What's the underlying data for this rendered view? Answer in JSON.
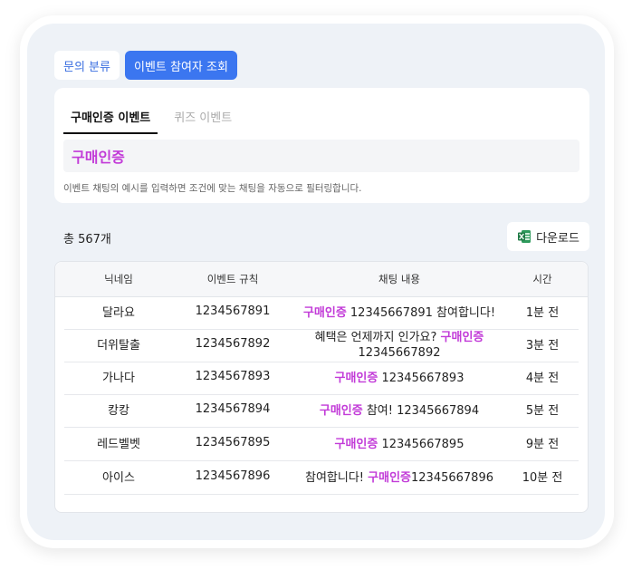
{
  "top_tabs": [
    {
      "label": "문의 분류",
      "active": false
    },
    {
      "label": "이벤트 참여자 조회",
      "active": true
    }
  ],
  "sub_tabs": [
    {
      "label": "구매인증 이벤트",
      "active": true
    },
    {
      "label": "퀴즈 이벤트",
      "active": false
    }
  ],
  "keyword": "구매인증",
  "help_text": "이벤트 채팅의 예시를 입력하면 조건에 맞는 채팅을 자동으로 필터링합니다.",
  "total_label": "총 567개",
  "download_label": "다운로드",
  "table": {
    "headers": [
      "닉네임",
      "이벤트 규칙",
      "채팅 내용",
      "시간"
    ],
    "rows": [
      {
        "nickname": "달라요",
        "rule": "1234567891",
        "chat": [
          {
            "t": "구매인증",
            "hl": true
          },
          {
            "t": " 12345667891 참여합니다!",
            "hl": false
          }
        ],
        "time": "1분 전"
      },
      {
        "nickname": "더위탈출",
        "rule": "1234567892",
        "chat": [
          {
            "t": "혜택은 언제까지 인가요? ",
            "hl": false
          },
          {
            "t": "구매인증",
            "hl": true
          },
          {
            "t": " 12345667892",
            "hl": false
          }
        ],
        "time": "3분 전"
      },
      {
        "nickname": "가나다",
        "rule": "1234567893",
        "chat": [
          {
            "t": "구매인증",
            "hl": true
          },
          {
            "t": " 12345667893",
            "hl": false
          }
        ],
        "time": "4분 전"
      },
      {
        "nickname": "캉캉",
        "rule": "1234567894",
        "chat": [
          {
            "t": "구매인증",
            "hl": true
          },
          {
            "t": " 참여! 12345667894",
            "hl": false
          }
        ],
        "time": "5분 전"
      },
      {
        "nickname": "레드벨벳",
        "rule": "1234567895",
        "chat": [
          {
            "t": "구매인증",
            "hl": true
          },
          {
            "t": " 12345667895",
            "hl": false
          }
        ],
        "time": "9분 전"
      },
      {
        "nickname": "아이스",
        "rule": "1234567896",
        "chat": [
          {
            "t": "참여합니다! ",
            "hl": false
          },
          {
            "t": "구매인증",
            "hl": true
          },
          {
            "t": "12345667896",
            "hl": false
          }
        ],
        "time": "10분 전"
      }
    ]
  },
  "icons": {
    "download": "excel-file-icon"
  },
  "colors": {
    "accent": "#3b76f0",
    "highlight": "#c23bd8",
    "excel": "#1f7a45"
  }
}
